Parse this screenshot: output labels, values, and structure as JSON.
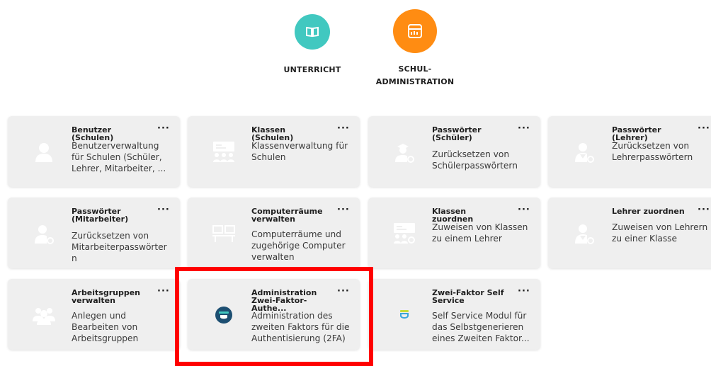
{
  "categories": [
    {
      "label": "UNTERRICHT",
      "icon": "book-icon",
      "color": "#41c8c0"
    },
    {
      "label": "SCHUL-\nADMINISTRATION",
      "icon": "admin-board-icon",
      "color": "#ff8c12"
    }
  ],
  "tiles": [
    {
      "title": "Benutzer (Schulen)",
      "menu": "···",
      "desc": "Benutzerverwaltung\nfür Schulen (Schüler,\nLehrer, Mitarbeiter, ...",
      "icon": "user-icon"
    },
    {
      "title": "Klassen (Schulen)",
      "menu": "···",
      "desc": "Klassenverwaltung für\nSchulen",
      "icon": "class-icon"
    },
    {
      "title": "Passwörter\n(Schüler)",
      "menu": "···",
      "desc": "Zurücksetzen von\nSchülerpasswörtern",
      "icon": "student-key-icon"
    },
    {
      "title": "Passwörter (Lehrer)",
      "menu": "···",
      "desc": "Zurücksetzen von\nLehrerpasswörtern",
      "icon": "teacher-key-icon"
    },
    {
      "title": "Passwörter\n(Mitarbeiter)",
      "menu": "···",
      "desc": "Zurücksetzen von\nMitarbeiterpasswörter\nn",
      "icon": "staff-key-icon"
    },
    {
      "title": "Computerräume\nverwalten",
      "menu": "···",
      "desc": "Computerräume und\nzugehörige Computer\nverwalten",
      "icon": "computer-room-icon"
    },
    {
      "title": "Klassen zuordnen",
      "menu": "···",
      "desc": "Zuweisen von Klassen\nzu einem Lehrer",
      "icon": "class-assign-icon"
    },
    {
      "title": "Lehrer zuordnen",
      "menu": "···",
      "desc": "Zuweisen von Lehrern\nzu einer Klasse",
      "icon": "teacher-assign-icon"
    },
    {
      "title": "Arbeitsgruppen\nverwalten",
      "menu": "···",
      "desc": "Anlegen und\nBearbeiten von\nArbeitsgruppen",
      "icon": "group-icon"
    },
    {
      "title": "Administration\nZwei-Faktor-Authe...",
      "menu": "···",
      "desc": "Administration des\nzweiten Faktors für die\nAuthentisierung (2FA)",
      "icon": "2fa-admin-icon"
    },
    {
      "title": "Zwei-Faktor Self\nService",
      "menu": "···",
      "desc": "Self Service Modul für\ndas Selbstgenerieren\neines Zweiten Faktor...",
      "icon": "2fa-self-service-icon"
    }
  ],
  "colors": {
    "tile_bg": "#efefef",
    "icon_gray": "#ffffff",
    "highlight": "#ff0000",
    "teal": "#41c8c0",
    "orange": "#ff8c12",
    "twofa_dark": "#1d4f72"
  }
}
